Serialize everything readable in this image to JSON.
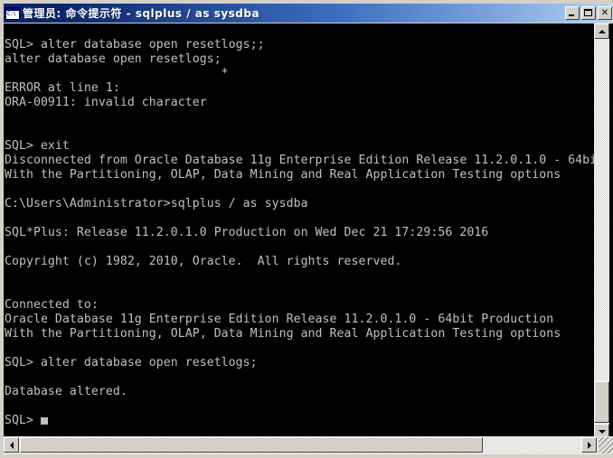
{
  "window": {
    "title": "管理员: 命令提示符 - sqlplus  / as sysdba",
    "icon": "console-icon",
    "icon_glyph": "C:\\",
    "colors": {
      "titlebar_start": "#0a246a",
      "titlebar_end": "#bdd6f0",
      "console_bg": "#000000",
      "console_fg": "#c0c0c0",
      "chrome": "#d4d0c8"
    },
    "buttons": {
      "minimize": "_",
      "maximize": "□",
      "close": "✕"
    }
  },
  "console": {
    "lines": [
      "",
      "SQL> alter database open resetlogs;;",
      "alter database open resetlogs;",
      "                              *",
      "ERROR at line 1:",
      "ORA-00911: invalid character",
      "",
      "",
      "SQL> exit",
      "Disconnected from Oracle Database 11g Enterprise Edition Release 11.2.0.1.0 - 64bi",
      "With the Partitioning, OLAP, Data Mining and Real Application Testing options",
      "",
      "C:\\Users\\Administrator>sqlplus / as sysdba",
      "",
      "SQL*Plus: Release 11.2.0.1.0 Production on Wed Dec 21 17:29:56 2016",
      "",
      "Copyright (c) 1982, 2010, Oracle.  All rights reserved.",
      "",
      "",
      "Connected to:",
      "Oracle Database 11g Enterprise Edition Release 11.2.0.1.0 - 64bit Production",
      "With the Partitioning, OLAP, Data Mining and Real Application Testing options",
      "",
      "SQL> alter database open resetlogs;",
      "",
      "Database altered.",
      "",
      "SQL> "
    ],
    "prompt": "SQL>",
    "cursor": "block"
  },
  "scrollbars": {
    "vertical": {
      "up_arrow": "▲",
      "down_arrow": "▼",
      "thumb_position": "bottom"
    },
    "horizontal": {
      "left_arrow": "◀",
      "right_arrow": "▶",
      "thumb_position": "left"
    }
  }
}
